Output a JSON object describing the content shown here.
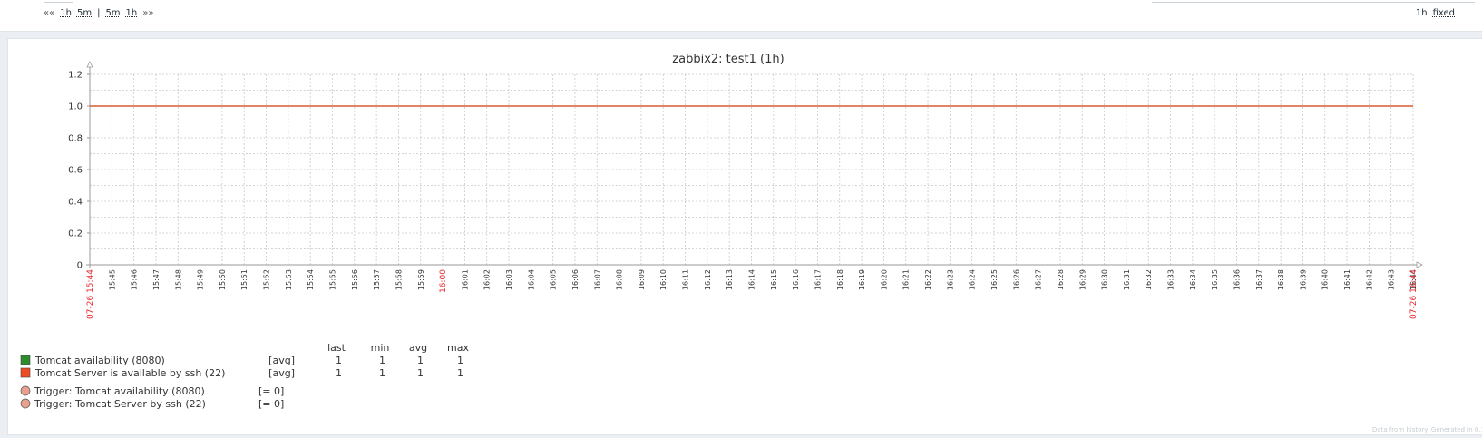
{
  "timeline": {
    "prev_all": "«« ",
    "zoom_links": [
      "1h",
      "5m"
    ],
    "separator": "|",
    "zoom_links_right": [
      "5m",
      "1h"
    ],
    "next_all": "»»",
    "period": "1h",
    "mode": "fixed"
  },
  "graph": {
    "title": "zabbix2: test1 (1h)",
    "footer": "Data from history. Generated in 0.1"
  },
  "legend": {
    "headers": [
      "last",
      "min",
      "avg",
      "max"
    ],
    "items": [
      {
        "name": "Tomcat availability (8080)",
        "func": "[avg]",
        "last": "1",
        "min": "1",
        "avg": "1",
        "max": "1",
        "color": "#2e8b2e"
      },
      {
        "name": "Tomcat Server is available by ssh (22)",
        "func": "[avg]",
        "last": "1",
        "min": "1",
        "avg": "1",
        "max": "1",
        "color": "#ef4b23"
      }
    ],
    "triggers": [
      {
        "name": "Trigger: Tomcat availability (8080)",
        "cond": "[= 0]",
        "color": "#e8a08f"
      },
      {
        "name": "Trigger: Tomcat Server by ssh (22)",
        "cond": "[= 0]",
        "color": "#e8a08f"
      }
    ]
  },
  "chart_data": {
    "type": "line",
    "title": "zabbix2: test1 (1h)",
    "ylim": [
      0,
      1.2
    ],
    "y_ticks": [
      "0",
      "0.2",
      "0.4",
      "0.6",
      "0.8",
      "1.0",
      "1.2"
    ],
    "x_start_label": "07-26 15:44",
    "x_end_label": "07-26 16:44",
    "x_ticks": [
      "15:45",
      "15:46",
      "15:47",
      "15:48",
      "15:49",
      "15:50",
      "15:51",
      "15:52",
      "15:53",
      "15:54",
      "15:55",
      "15:56",
      "15:57",
      "15:58",
      "15:59",
      "16:00",
      "16:01",
      "16:02",
      "16:03",
      "16:04",
      "16:05",
      "16:06",
      "16:07",
      "16:08",
      "16:09",
      "16:10",
      "16:11",
      "16:12",
      "16:13",
      "16:14",
      "16:15",
      "16:16",
      "16:17",
      "16:18",
      "16:19",
      "16:20",
      "16:21",
      "16:22",
      "16:23",
      "16:24",
      "16:25",
      "16:26",
      "16:27",
      "16:28",
      "16:29",
      "16:30",
      "16:31",
      "16:32",
      "16:33",
      "16:34",
      "16:35",
      "16:36",
      "16:37",
      "16:38",
      "16:39",
      "16:40",
      "16:41",
      "16:42",
      "16:43",
      "16:44"
    ],
    "highlight_tick": "16:00",
    "series": [
      {
        "name": "Tomcat availability (8080)",
        "color": "#2e8b2e",
        "x": [
          "15:44",
          "16:44"
        ],
        "values": [
          1,
          1
        ]
      },
      {
        "name": "Tomcat Server is available by ssh (22)",
        "color": "#ef4b23",
        "x": [
          "15:44",
          "16:44"
        ],
        "values": [
          1,
          1
        ]
      }
    ]
  }
}
